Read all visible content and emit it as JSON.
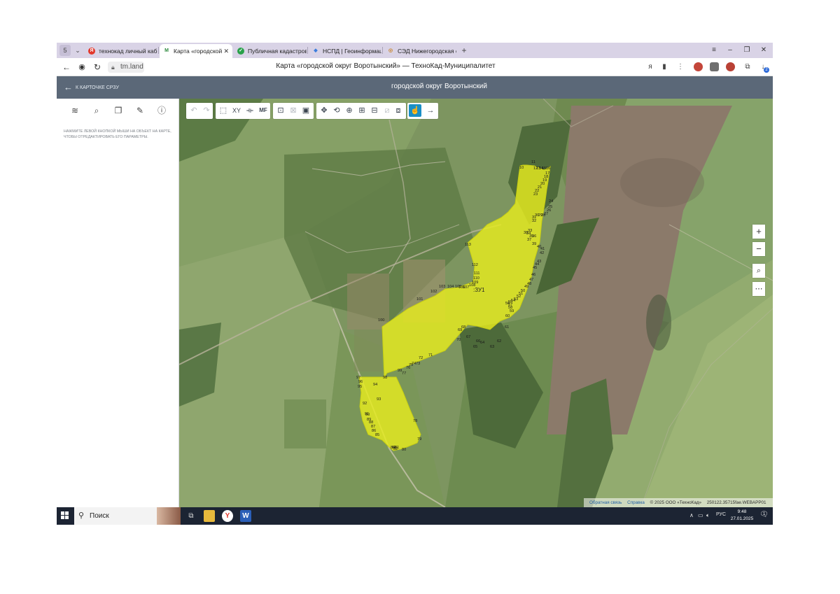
{
  "browser": {
    "tab_count": "5",
    "tabs": [
      {
        "label": "технокад личный кабинет",
        "favicon": "Я",
        "color": "#e2372b"
      },
      {
        "label": "Карта «городской округ Воротынский»",
        "favicon": "M",
        "color": "#2d8a3e"
      },
      {
        "label": "Публичная кадастровая карта",
        "favicon": "✓",
        "color": "#2aa14a"
      },
      {
        "label": "НСПД | Геоинформационная система",
        "favicon": "◆",
        "color": "#3b7ddd"
      },
      {
        "label": "СЭД Нижегородская область",
        "favicon": "◎",
        "color": "#c9852c"
      }
    ],
    "url": "tm.land",
    "page_title": "Карта «городской округ Воротынский» — ТехноКад-Муниципалитет",
    "download_badge": "2"
  },
  "app": {
    "back_label": "К КАРТОЧКЕ СРЗУ",
    "title": "городской округ Воротынский",
    "sidebar_hint": "Нажмите левой кнопкой мыши на объект на карте, чтобы отредактировать его параметры."
  },
  "map": {
    "parcel_label": ":ЗУ1",
    "vertex_labels": [
      "10",
      "11",
      "12",
      "13",
      "14",
      "15",
      "16",
      "17",
      "18",
      "19",
      "20",
      "21",
      "22",
      "23",
      "24",
      "25",
      "26",
      "27",
      "28",
      "29",
      "30",
      "31",
      "32",
      "33",
      "34",
      "35",
      "36",
      "37",
      "38",
      "39",
      "40",
      "41",
      "42",
      "43",
      "44",
      "45",
      "46",
      "47",
      "48",
      "49",
      "50",
      "51",
      "52",
      "53",
      "54",
      "55",
      "56",
      "57",
      "58",
      "59",
      "60",
      "61",
      "62",
      "63",
      "64",
      "65",
      "66",
      "67",
      "68",
      "69",
      "70",
      "71",
      "72",
      "73",
      "74",
      "75",
      "76",
      "77",
      "78",
      "79",
      "80",
      "81",
      "82",
      "83",
      "84",
      "85",
      "86",
      "87",
      "88",
      "89",
      "90",
      "91",
      "92",
      "93",
      "94",
      "95",
      "96",
      "97",
      "98",
      "99",
      "100",
      "101",
      "102",
      "103",
      "104",
      "105",
      "106",
      "107",
      "108",
      "109",
      "110",
      "111",
      "112",
      "113"
    ],
    "footer": {
      "feedback": "Обратная связь",
      "help": "Справка",
      "copyright": "© 2025 ООО «ТехноКад»",
      "version": "250122.35715fae.WEBAPP01"
    },
    "colors": {
      "parcel_fill": "#e6ec1f",
      "parcel_stroke": "#c8cf12",
      "field_light": "#8ca06a",
      "field_dark": "#5f7a45",
      "plowed": "#8b7a68"
    }
  },
  "taskbar": {
    "search_label": "Поиск",
    "language": "РУС",
    "time": "9:48",
    "date": "27.01.2025",
    "notifications": "1"
  }
}
